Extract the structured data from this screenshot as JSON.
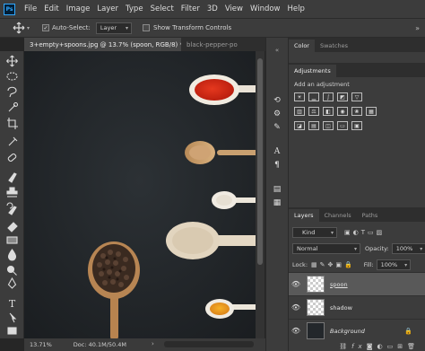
{
  "app": {
    "logo": "Ps"
  },
  "menu": [
    "File",
    "Edit",
    "Image",
    "Layer",
    "Type",
    "Select",
    "Filter",
    "3D",
    "View",
    "Window",
    "Help"
  ],
  "options": {
    "auto_select_label": "Auto-Select:",
    "auto_select_checked": true,
    "target_value": "Layer",
    "transform_label": "Show Transform Controls",
    "transform_checked": false
  },
  "tabs": {
    "active": "3+empty+spoons.jpg @ 13.7% (spoon, RGB/8) *",
    "inactive": "black-pepper-po"
  },
  "status": {
    "zoom": "13.71%",
    "doc": "Doc: 40.1M/50.4M"
  },
  "panels": {
    "top_tabs": [
      "Color",
      "Swatches"
    ],
    "adjustments_tab": "Adjustments",
    "add_adjustment": "Add an adjustment",
    "layers_tabs": [
      "Layers",
      "Channels",
      "Paths"
    ],
    "filter_kind": "Kind",
    "blend_mode": "Normal",
    "opacity_label": "Opacity:",
    "opacity_value": "100%",
    "lock_label": "Lock:",
    "fill_label": "Fill:",
    "fill_value": "100%"
  },
  "layers": [
    {
      "name": "spoon",
      "selected": true
    },
    {
      "name": "shadow",
      "selected": false
    },
    {
      "name": "Background",
      "selected": false,
      "locked": true
    }
  ],
  "colors": {
    "accent": "#31a8ff",
    "background": "#262626",
    "panel": "#3c3c3c"
  },
  "icons": {
    "tools": [
      "move-icon",
      "marquee-icon",
      "lasso-icon",
      "quick-select-icon",
      "crop-icon",
      "eyedropper-icon",
      "healing-icon",
      "brush-icon",
      "stamp-icon",
      "history-brush-icon",
      "eraser-icon",
      "gradient-icon",
      "blur-icon",
      "dodge-icon",
      "pen-icon",
      "type-icon",
      "path-select-icon",
      "rectangle-icon",
      "hand-icon",
      "zoom-icon"
    ],
    "mid": [
      "history-icon",
      "properties-icon",
      "brush-settings-icon",
      "paragraph-icon",
      "character-icon",
      "libraries-icon",
      "styles-icon"
    ]
  }
}
